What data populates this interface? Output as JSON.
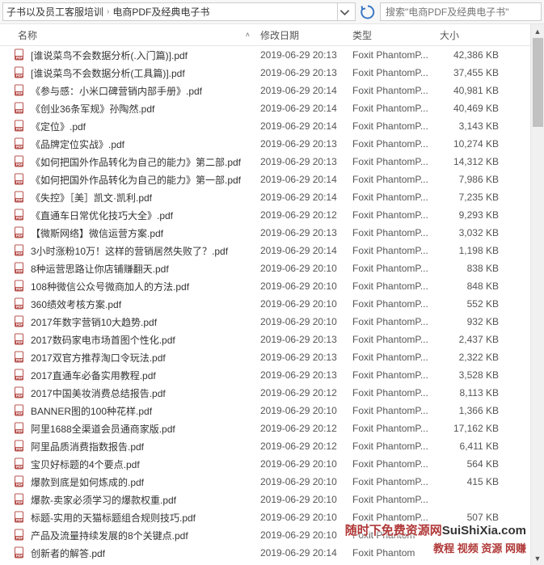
{
  "breadcrumb": {
    "seg1": "子书以及员工客服培训",
    "seg2": "电商PDF及经典电子书"
  },
  "search": {
    "placeholder": "搜索\"电商PDF及经典电子书\""
  },
  "columns": {
    "name": "名称",
    "date": "修改日期",
    "type": "类型",
    "size": "大小"
  },
  "files": [
    {
      "name": "[谁说菜鸟不会数据分析(.入门篇)].pdf",
      "date": "2019-06-29 20:13",
      "type": "Foxit PhantomP...",
      "size": "42,386 KB"
    },
    {
      "name": "[谁说菜鸟不会数据分析(工具篇)].pdf",
      "date": "2019-06-29 20:13",
      "type": "Foxit PhantomP...",
      "size": "37,455 KB"
    },
    {
      "name": "《参与感：小米口碑营销内部手册》.pdf",
      "date": "2019-06-29 20:14",
      "type": "Foxit PhantomP...",
      "size": "40,981 KB"
    },
    {
      "name": "《创业36条军规》孙陶然.pdf",
      "date": "2019-06-29 20:14",
      "type": "Foxit PhantomP...",
      "size": "40,469 KB"
    },
    {
      "name": "《定位》.pdf",
      "date": "2019-06-29 20:14",
      "type": "Foxit PhantomP...",
      "size": "3,143 KB"
    },
    {
      "name": "《品牌定位实战》.pdf",
      "date": "2019-06-29 20:13",
      "type": "Foxit PhantomP...",
      "size": "10,274 KB"
    },
    {
      "name": "《如何把国外作品转化为自己的能力》第二部.pdf",
      "date": "2019-06-29 20:13",
      "type": "Foxit PhantomP...",
      "size": "14,312 KB"
    },
    {
      "name": "《如何把国外作品转化为自己的能力》第一部.pdf",
      "date": "2019-06-29 20:14",
      "type": "Foxit PhantomP...",
      "size": "7,986 KB"
    },
    {
      "name": "《失控》［美］凯文·凯利.pdf",
      "date": "2019-06-29 20:14",
      "type": "Foxit PhantomP...",
      "size": "7,235 KB"
    },
    {
      "name": "《直通车日常优化技巧大全》.pdf",
      "date": "2019-06-29 20:12",
      "type": "Foxit PhantomP...",
      "size": "9,293 KB"
    },
    {
      "name": "【微斯网络】微信运营方案.pdf",
      "date": "2019-06-29 20:13",
      "type": "Foxit PhantomP...",
      "size": "3,032 KB"
    },
    {
      "name": "3小时涨粉10万！这样的营销居然失败了？.pdf",
      "date": "2019-06-29 20:14",
      "type": "Foxit PhantomP...",
      "size": "1,198 KB"
    },
    {
      "name": "8种运营思路让你店铺赚翻天.pdf",
      "date": "2019-06-29 20:10",
      "type": "Foxit PhantomP...",
      "size": "838 KB"
    },
    {
      "name": "108种微信公众号微商加人的方法.pdf",
      "date": "2019-06-29 20:10",
      "type": "Foxit PhantomP...",
      "size": "848 KB"
    },
    {
      "name": "360绩效考核方案.pdf",
      "date": "2019-06-29 20:10",
      "type": "Foxit PhantomP...",
      "size": "552 KB"
    },
    {
      "name": "2017年数字营销10大趋势.pdf",
      "date": "2019-06-29 20:10",
      "type": "Foxit PhantomP...",
      "size": "932 KB"
    },
    {
      "name": "2017数码家电市场首图个性化.pdf",
      "date": "2019-06-29 20:13",
      "type": "Foxit PhantomP...",
      "size": "2,437 KB"
    },
    {
      "name": "2017双官方推荐淘口令玩法.pdf",
      "date": "2019-06-29 20:13",
      "type": "Foxit PhantomP...",
      "size": "2,322 KB"
    },
    {
      "name": "2017直通车必备实用教程.pdf",
      "date": "2019-06-29 20:13",
      "type": "Foxit PhantomP...",
      "size": "3,528 KB"
    },
    {
      "name": "2017中国美妆消费总结报告.pdf",
      "date": "2019-06-29 20:12",
      "type": "Foxit PhantomP...",
      "size": "8,113 KB"
    },
    {
      "name": "BANNER图的100种花样.pdf",
      "date": "2019-06-29 20:10",
      "type": "Foxit PhantomP...",
      "size": "1,366 KB"
    },
    {
      "name": "阿里1688全渠道会员通商家版.pdf",
      "date": "2019-06-29 20:12",
      "type": "Foxit PhantomP...",
      "size": "17,162 KB"
    },
    {
      "name": "阿里品质消费指数报告.pdf",
      "date": "2019-06-29 20:12",
      "type": "Foxit PhantomP...",
      "size": "6,411 KB"
    },
    {
      "name": "宝贝好标题的4个要点.pdf",
      "date": "2019-06-29 20:10",
      "type": "Foxit PhantomP...",
      "size": "564 KB"
    },
    {
      "name": "爆款到底是如何炼成的.pdf",
      "date": "2019-06-29 20:10",
      "type": "Foxit PhantomP...",
      "size": "415 KB"
    },
    {
      "name": "爆款-卖家必须学习的爆款权重.pdf",
      "date": "2019-06-29 20:10",
      "type": "Foxit PhantomP...",
      "size": ""
    },
    {
      "name": "标题-实用的天猫标题组合规则技巧.pdf",
      "date": "2019-06-29 20:10",
      "type": "Foxit PhantomP...",
      "size": "507 KB"
    },
    {
      "name": "产品及流量持续发展的8个关键点.pdf",
      "date": "2019-06-29 20:10",
      "type": "Foxit Phantom",
      "size": ""
    },
    {
      "name": "创新者的解答.pdf",
      "date": "2019-06-29 20:14",
      "type": "Foxit Phantom",
      "size": ""
    }
  ],
  "watermark": {
    "line1_a": "随时下免费资源网",
    "line1_b": "SuiShiXia.com",
    "line2": "教程 视频 资源 网赚"
  }
}
